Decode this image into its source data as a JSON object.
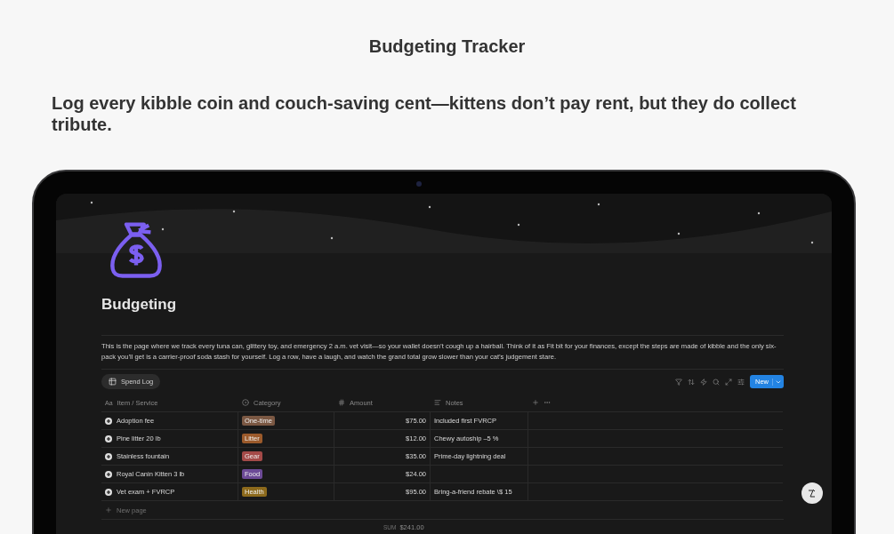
{
  "title": "Budgeting Tracker",
  "subtitle": "Log every kibble coin and couch-saving cent—kittens don’t pay rent, but they do collect tribute.",
  "page": {
    "title": "Budgeting",
    "description": "This is the page where we track every tuna can, glittery toy, and emergency 2 a.m. vet visit—so your wallet doesn’t cough up a hairball. Think of it as Fit bit for your finances, except the steps are made of kibble and the only six-pack you’ll get is a carrier-proof soda stash for yourself. Log a row, have a laugh, and watch the grand total grow slower than your cat’s judgement stare.",
    "view_tab": {
      "label": "Spend Log",
      "selected": true
    },
    "new_button": "New",
    "columns": [
      {
        "label": "Item / Service",
        "kind": "title",
        "icon_text": "Aa"
      },
      {
        "label": "Category",
        "kind": "select"
      },
      {
        "label": "Amount",
        "kind": "number"
      },
      {
        "label": "Notes",
        "kind": "text"
      }
    ],
    "rows": [
      {
        "item": "Adoption fee",
        "category": {
          "label": "One-time",
          "color": "#7b5843"
        },
        "amount": "$75.00",
        "notes": "Included first FVRCP"
      },
      {
        "item": "Pine litter 20 lb",
        "category": {
          "label": "Litter",
          "color": "#9b5a2b"
        },
        "amount": "$12.00",
        "notes": "Chewy autoship –5 %"
      },
      {
        "item": "Stainless fountain",
        "category": {
          "label": "Gear",
          "color": "#a44a48"
        },
        "amount": "$35.00",
        "notes": "Prime-day lightning deal"
      },
      {
        "item": "Royal Canin Kitten 3 lb",
        "category": {
          "label": "Food",
          "color": "#6c4a96"
        },
        "amount": "$24.00"
      },
      {
        "item": "Vet exam + FVRCP",
        "category": {
          "label": "Health",
          "color": "#8d6a1c"
        },
        "amount": "$95.00",
        "notes": "Bring-a-friend rebate \\$ 15"
      }
    ],
    "new_page": "New page",
    "sum_label": "SUM",
    "sum_value": "$241.00"
  }
}
